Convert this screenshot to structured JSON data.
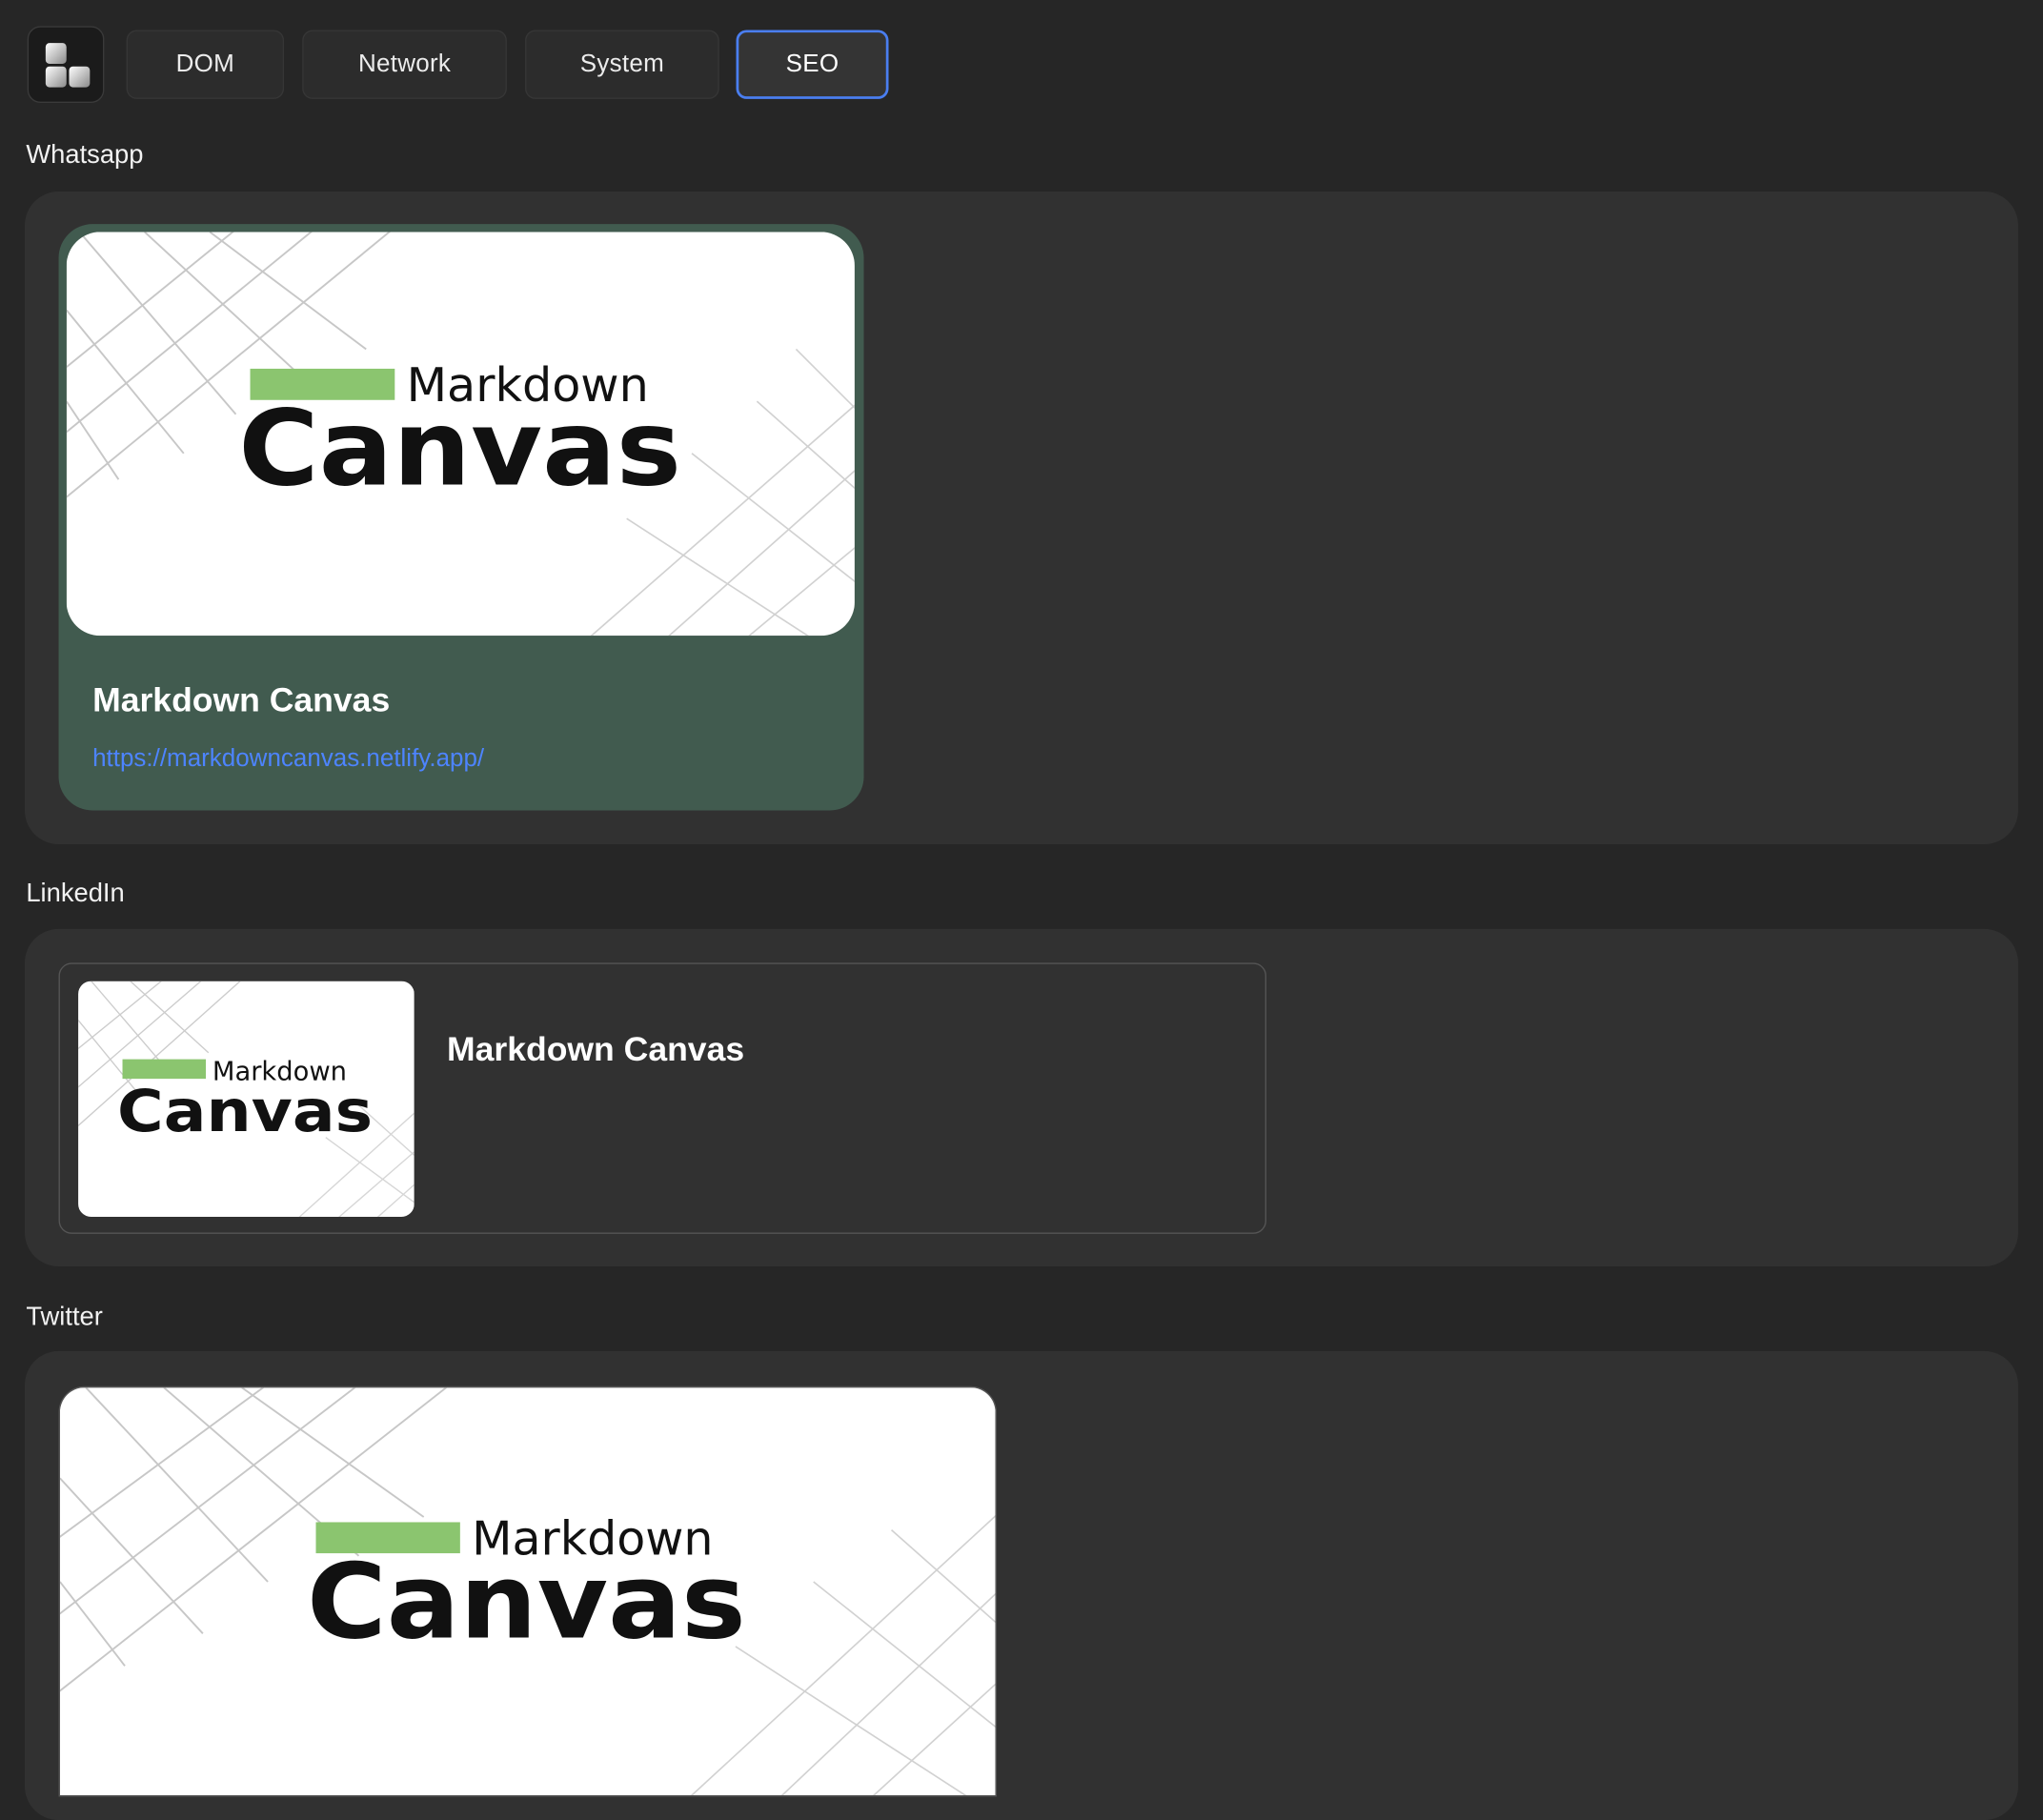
{
  "toolbar": {
    "logo_icon": "app-logo-icon",
    "tabs": [
      {
        "label": "DOM",
        "active": false
      },
      {
        "label": "Network",
        "active": false
      },
      {
        "label": "System",
        "active": false
      },
      {
        "label": "SEO",
        "active": true
      }
    ]
  },
  "whatsapp": {
    "section_title": "Whatsapp",
    "card": {
      "image_text_top": "Markdown",
      "image_text_bottom": "Canvas",
      "title": "Markdown Canvas",
      "url": "https://markdowncanvas.netlify.app/"
    },
    "card_color": "#415b4f",
    "link_color": "#4d84ff"
  },
  "linkedin": {
    "section_title": "LinkedIn",
    "card": {
      "image_text_top": "Markdown",
      "image_text_bottom": "Canvas",
      "title": "Markdown Canvas"
    }
  },
  "twitter": {
    "section_title": "Twitter",
    "card": {
      "image_text_top": "Markdown",
      "image_text_bottom": "Canvas"
    }
  },
  "colors": {
    "background": "#262626",
    "panel": "#313131",
    "accent_bar": "#8bc56f",
    "active_tab_border": "#4a7ef0"
  }
}
